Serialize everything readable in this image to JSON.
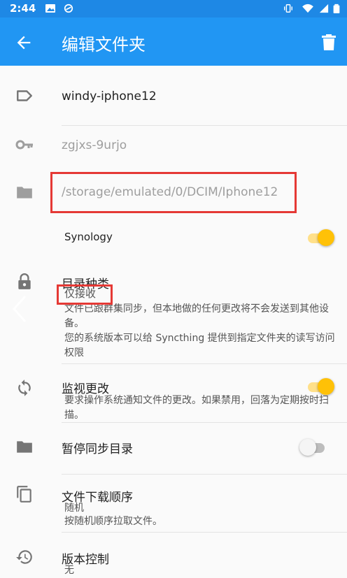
{
  "status_bar": {
    "time": "2:44"
  },
  "app_bar": {
    "title": "编辑文件夹"
  },
  "folder": {
    "label": "windy-iphone12",
    "id": "zgjxs-9urjo",
    "path": "/storage/emulated/0/DCIM/Iphone12"
  },
  "devices": [
    {
      "name": "Synology",
      "enabled": true
    }
  ],
  "folder_type": {
    "title": "目录种类",
    "value": "仅接收",
    "desc1": "文件已跟群集同步，但本地做的任何更改将不会发送到其他设",
    "desc2": "备。",
    "desc3": "您的系统版本可以给 Syncthing 提供到指定文件夹的读写访问",
    "desc4": "权限"
  },
  "watch_changes": {
    "title": "监视更改",
    "desc1": "要求操作系统通知文件的更改。如果禁用，回落为定期按时扫",
    "desc2": "描。",
    "enabled": true
  },
  "pause_sync": {
    "title": "暂停同步目录",
    "enabled": false
  },
  "pull_order": {
    "title": "文件下载顺序",
    "value": "随机",
    "desc": "按随机顺序拉取文件。"
  },
  "versioning": {
    "title": "版本控制",
    "value": "无"
  },
  "colors": {
    "primary": "#2196f3",
    "status_bar": "#1e88e5",
    "accent": "#ffc107",
    "highlight": "#e53935"
  },
  "icons": [
    "back-arrow-icon",
    "trash-icon",
    "label-tag-icon",
    "key-icon",
    "folder-icon",
    "lock-icon",
    "sync-icon",
    "copy-icon",
    "history-icon"
  ]
}
